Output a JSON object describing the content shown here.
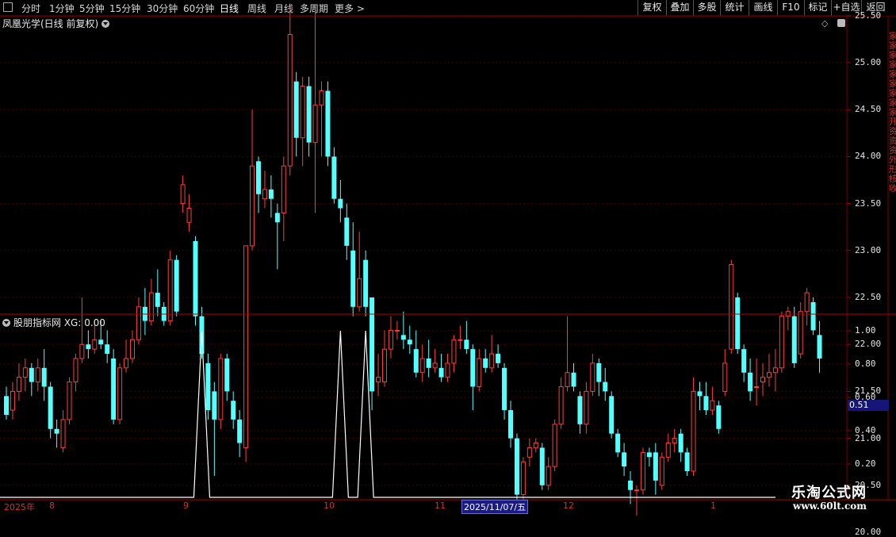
{
  "toolbar": {
    "periods": [
      "分时",
      "1分钟",
      "5分钟",
      "15分钟",
      "30分钟",
      "60分钟",
      "日线",
      "周线",
      "月线",
      "多周期",
      "更多 >"
    ],
    "active_period": "日线",
    "right_buttons": [
      "复权",
      "叠加",
      "多股",
      "统计",
      "画线",
      "F10",
      "标记",
      "+自选",
      "返回"
    ]
  },
  "main_panel": {
    "title": "凤凰光学(日线 前复权)",
    "y_ticks": [
      "25.50",
      "25.00",
      "24.50",
      "24.00",
      "23.50",
      "23.00",
      "22.50",
      "22.00",
      "21.50",
      "21.00",
      "20.50",
      "20.00"
    ]
  },
  "indicator_panel": {
    "title": "股朋指标网  XG: 0.00",
    "y_ticks": [
      "1.00",
      "0.80",
      "0.60",
      "0.40",
      "0.20"
    ],
    "current_value": "0.51"
  },
  "x_axis": {
    "labels": [
      "2025年",
      "8",
      "9",
      "10",
      "11",
      "12",
      "1"
    ],
    "cursor_date": "2025/11/07/五"
  },
  "side_text": "家家家家家家家家家开资资资外形核收",
  "watermark": {
    "title": "乐淘公式网",
    "url": "www.60lt.com"
  },
  "colors": {
    "up": "#ff3d3d",
    "down": "#54ffff",
    "signal": "#ffffff",
    "grid": "#4a0000"
  },
  "chart_data": {
    "type": "candlestick",
    "title": "凤凰光学(日线 前复权)",
    "ylim": [
      19.8,
      25.8
    ],
    "candles": [
      [
        21.45,
        21.25,
        21.55,
        21.2
      ],
      [
        21.3,
        21.5,
        21.6,
        21.2
      ],
      [
        21.5,
        21.65,
        21.8,
        21.4
      ],
      [
        21.65,
        21.75,
        21.85,
        21.5
      ],
      [
        21.75,
        21.6,
        21.8,
        21.45
      ],
      [
        21.6,
        21.75,
        21.85,
        21.5
      ],
      [
        21.75,
        21.55,
        21.95,
        21.4
      ],
      [
        21.55,
        21.1,
        21.6,
        21.0
      ],
      [
        21.1,
        21.05,
        21.2,
        20.9
      ],
      [
        20.9,
        21.2,
        21.3,
        20.85
      ],
      [
        21.2,
        21.6,
        21.65,
        21.15
      ],
      [
        21.6,
        21.85,
        21.9,
        21.5
      ],
      [
        21.85,
        22.0,
        22.5,
        21.8
      ],
      [
        22.0,
        21.95,
        22.15,
        21.85
      ],
      [
        21.95,
        22.05,
        22.25,
        21.9
      ],
      [
        22.05,
        22.0,
        22.25,
        21.95
      ],
      [
        22.0,
        21.9,
        22.15,
        21.8
      ],
      [
        21.85,
        21.2,
        21.95,
        21.15
      ],
      [
        21.2,
        21.75,
        21.8,
        21.15
      ],
      [
        21.75,
        21.85,
        22.05,
        21.7
      ],
      [
        21.85,
        22.05,
        22.15,
        21.8
      ],
      [
        22.05,
        22.4,
        22.5,
        22.0
      ],
      [
        22.4,
        22.25,
        22.6,
        22.1
      ],
      [
        22.25,
        22.55,
        22.7,
        22.2
      ],
      [
        22.55,
        22.4,
        22.8,
        22.3
      ],
      [
        22.4,
        22.25,
        22.45,
        22.2
      ],
      [
        22.25,
        22.9,
        23.0,
        22.2
      ],
      [
        22.9,
        22.35,
        22.95,
        22.3
      ],
      [
        23.5,
        23.7,
        23.8,
        23.4
      ],
      [
        23.3,
        23.45,
        23.6,
        23.2
      ],
      [
        23.1,
        22.3,
        23.15,
        22.2
      ],
      [
        22.3,
        21.9,
        22.4,
        21.85
      ],
      [
        21.8,
        21.3,
        21.9,
        21.2
      ],
      [
        21.5,
        21.2,
        21.6,
        20.6
      ],
      [
        21.2,
        21.85,
        21.9,
        21.1
      ],
      [
        21.85,
        21.5,
        21.9,
        21.4
      ],
      [
        21.4,
        21.2,
        21.5,
        21.1
      ],
      [
        21.2,
        20.95,
        21.3,
        20.8
      ],
      [
        20.9,
        23.05,
        23.05,
        20.75
      ],
      [
        23.05,
        23.9,
        24.5,
        23.0
      ],
      [
        23.95,
        23.6,
        24.0,
        23.4
      ],
      [
        23.55,
        23.65,
        23.85,
        23.45
      ],
      [
        23.65,
        23.55,
        23.8,
        23.35
      ],
      [
        23.4,
        23.3,
        23.5,
        22.8
      ],
      [
        23.4,
        23.9,
        24.0,
        23.1
      ],
      [
        23.9,
        25.3,
        25.6,
        23.8
      ],
      [
        24.8,
        24.2,
        24.9,
        24.0
      ],
      [
        24.2,
        24.75,
        24.85,
        23.9
      ],
      [
        24.75,
        24.15,
        24.85,
        24.0
      ],
      [
        24.15,
        24.55,
        25.6,
        23.4
      ],
      [
        24.55,
        24.7,
        24.8,
        24.0
      ],
      [
        24.7,
        24.0,
        24.8,
        23.9
      ],
      [
        24.0,
        23.55,
        24.1,
        23.5
      ],
      [
        23.55,
        23.45,
        23.75,
        23.3
      ],
      [
        23.35,
        23.05,
        23.5,
        22.9
      ],
      [
        23.0,
        22.4,
        23.3,
        22.3
      ],
      [
        22.4,
        22.7,
        23.2,
        22.35
      ],
      [
        22.9,
        22.4,
        23.0,
        22.3
      ],
      [
        22.5,
        21.5,
        22.5,
        21.3
      ],
      [
        21.6,
        21.65,
        21.9,
        21.45
      ],
      [
        21.6,
        21.95,
        22.15,
        21.55
      ],
      [
        21.95,
        22.15,
        22.3,
        21.85
      ],
      [
        22.15,
        22.15,
        22.25,
        22.05
      ],
      [
        22.1,
        22.05,
        22.35,
        21.95
      ],
      [
        22.05,
        22.0,
        22.2,
        21.9
      ],
      [
        21.95,
        21.7,
        22.15,
        21.65
      ],
      [
        21.7,
        21.85,
        22.0,
        21.6
      ],
      [
        21.85,
        21.75,
        22.05,
        21.65
      ],
      [
        21.75,
        21.8,
        21.95,
        21.7
      ],
      [
        21.75,
        21.65,
        21.9,
        21.6
      ],
      [
        21.65,
        21.8,
        21.9,
        21.6
      ],
      [
        21.8,
        22.05,
        22.1,
        21.7
      ],
      [
        22.05,
        22.05,
        22.2,
        21.95
      ],
      [
        22.05,
        21.95,
        22.25,
        21.9
      ],
      [
        21.95,
        21.55,
        22.0,
        21.3
      ],
      [
        21.55,
        21.85,
        21.95,
        21.5
      ],
      [
        21.85,
        21.75,
        21.95,
        21.7
      ],
      [
        21.75,
        21.9,
        22.1,
        21.7
      ],
      [
        21.9,
        21.8,
        22.0,
        21.75
      ],
      [
        21.75,
        21.3,
        21.8,
        21.2
      ],
      [
        21.3,
        21.0,
        21.4,
        20.9
      ],
      [
        21.0,
        20.4,
        21.05,
        20.35
      ],
      [
        20.4,
        20.75,
        20.8,
        20.35
      ],
      [
        20.8,
        20.9,
        21.0,
        20.7
      ],
      [
        20.9,
        20.95,
        21.0,
        20.85
      ],
      [
        20.9,
        20.5,
        20.95,
        20.45
      ],
      [
        20.5,
        20.7,
        20.8,
        20.45
      ],
      [
        20.7,
        21.15,
        21.2,
        20.65
      ],
      [
        21.15,
        21.55,
        21.65,
        21.1
      ],
      [
        21.55,
        21.7,
        22.3,
        21.5
      ],
      [
        21.7,
        21.55,
        21.8,
        21.5
      ],
      [
        21.45,
        21.15,
        21.5,
        21.05
      ],
      [
        21.15,
        21.5,
        21.6,
        21.05
      ],
      [
        21.5,
        21.8,
        21.9,
        21.45
      ],
      [
        21.8,
        21.6,
        21.85,
        21.45
      ],
      [
        21.6,
        21.5,
        21.75,
        21.4
      ],
      [
        21.45,
        21.05,
        21.5,
        21.0
      ],
      [
        21.05,
        20.85,
        21.1,
        20.8
      ],
      [
        20.85,
        20.7,
        20.95,
        20.6
      ],
      [
        20.55,
        20.45,
        20.65,
        20.3
      ],
      [
        20.45,
        20.45,
        20.5,
        20.0
      ],
      [
        20.45,
        20.85,
        20.9,
        20.4
      ],
      [
        20.85,
        20.8,
        20.9,
        20.7
      ],
      [
        20.85,
        20.55,
        20.95,
        20.4
      ],
      [
        20.5,
        20.8,
        20.85,
        20.45
      ],
      [
        20.8,
        20.95,
        21.05,
        20.75
      ],
      [
        20.95,
        21.0,
        21.1,
        20.85
      ],
      [
        21.05,
        20.85,
        21.1,
        20.75
      ],
      [
        20.85,
        20.65,
        20.9,
        20.6
      ],
      [
        20.65,
        21.5,
        21.65,
        20.6
      ],
      [
        21.5,
        21.45,
        21.6,
        21.3
      ],
      [
        21.45,
        21.3,
        21.6,
        21.25
      ],
      [
        21.3,
        21.4,
        21.55,
        21.25
      ],
      [
        21.35,
        21.1,
        21.4,
        21.05
      ],
      [
        21.5,
        21.8,
        21.95,
        21.45
      ],
      [
        21.95,
        22.85,
        22.9,
        21.9
      ],
      [
        22.5,
        21.95,
        22.55,
        21.9
      ],
      [
        21.95,
        21.7,
        22.0,
        21.6
      ],
      [
        21.7,
        21.5,
        21.85,
        21.4
      ],
      [
        21.55,
        21.55,
        21.85,
        21.35
      ],
      [
        21.6,
        21.65,
        21.8,
        21.45
      ],
      [
        21.65,
        21.7,
        21.9,
        21.55
      ],
      [
        21.7,
        21.75,
        21.95,
        21.5
      ],
      [
        21.75,
        22.3,
        22.35,
        21.7
      ],
      [
        22.3,
        22.35,
        22.4,
        22.15
      ],
      [
        22.3,
        21.8,
        22.4,
        21.75
      ],
      [
        21.9,
        22.35,
        22.45,
        21.85
      ],
      [
        22.35,
        22.55,
        22.6,
        22.2
      ],
      [
        22.45,
        22.15,
        22.5,
        22.1
      ],
      [
        22.1,
        21.85,
        22.25,
        21.7
      ]
    ]
  },
  "indicator_data": {
    "type": "line",
    "ylim": [
      0,
      1.05
    ],
    "signal_days": [
      31,
      53,
      57
    ]
  }
}
